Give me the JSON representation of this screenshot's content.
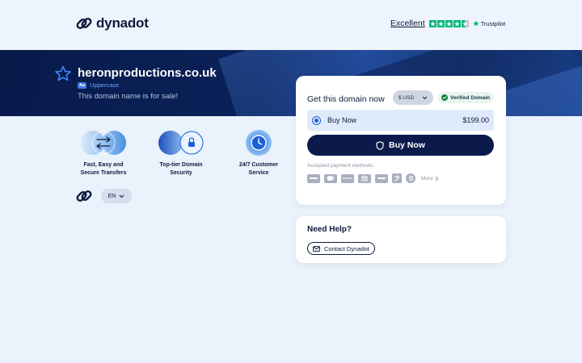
{
  "brand": {
    "name": "dynadot"
  },
  "trustpilot": {
    "rating_text": "Excellent",
    "brand": "Trustpilot",
    "stars": 4.5
  },
  "hero": {
    "domain": "heronproductions.co.uk",
    "case_label": "Uppercase",
    "case_badge": "Aa",
    "subtitle": "This domain name is for sale!"
  },
  "features": [
    {
      "line1": "Fast, Easy and",
      "line2": "Secure Transfers",
      "icon": "transfer-arrows-icon"
    },
    {
      "line1": "Top-tier Domain",
      "line2": "Security",
      "icon": "lock-icon"
    },
    {
      "line1": "24/7 Customer",
      "line2": "Service",
      "icon": "clock-icon"
    }
  ],
  "language": {
    "selected": "EN"
  },
  "buy_card": {
    "title": "Get this domain now",
    "currency": "$ USD",
    "verified": "Verified Domain",
    "option_label": "Buy Now",
    "option_price": "$199.00",
    "button_label": "Buy Now",
    "payments_label": "Accepted payment methods:",
    "payment_methods": [
      "visa-icon",
      "mastercard-icon",
      "discover-icon",
      "bank-icon",
      "paypal-icon",
      "alipay-icon",
      "bitcoin-icon"
    ],
    "more_label": "More"
  },
  "help_card": {
    "title": "Need Help?",
    "contact_label": "Contact Dynadot"
  },
  "colors": {
    "navy": "#0b1a4a",
    "accent_blue": "#1f5fd6",
    "trustpilot_green": "#00b67a",
    "background": "#eaf2fc"
  }
}
